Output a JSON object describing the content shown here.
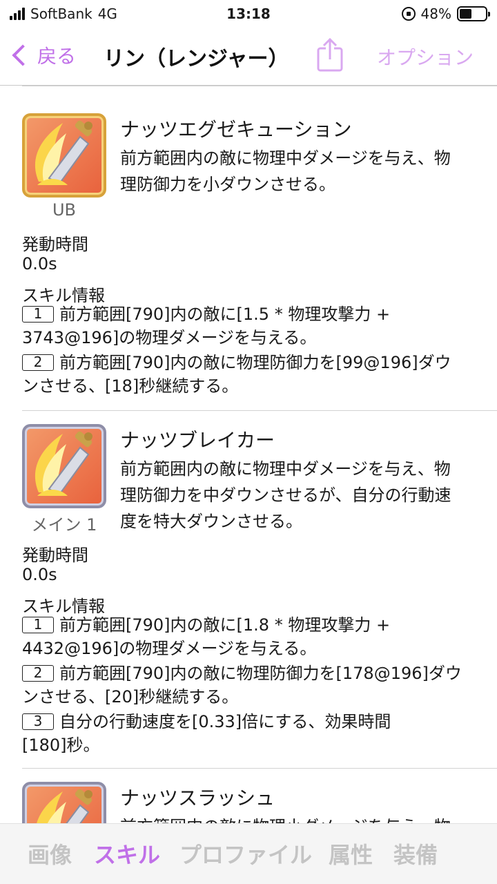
{
  "status": {
    "carrier": "SoftBank",
    "network": "4G",
    "time": "13:18",
    "battery": "48%",
    "battery_level": 0.48
  },
  "nav": {
    "back_label": "戻る",
    "title": "リン（レンジャー）",
    "options_label": "オプション"
  },
  "skills": [
    {
      "name": "ナッツエグゼキューション",
      "label": "UB",
      "desc_lines": [
        "前方範囲内の敵に物理中ダメージを与え、物",
        "理防御力を小ダウンさせる。"
      ],
      "cast_time_label": "発動時間",
      "cast_time": "0.0s",
      "info_label": "スキル情報",
      "info": [
        {
          "num": "1",
          "lines": [
            "前方範囲[790]内の敵に[1.5 * 物理攻撃力 +",
            "3743@196]の物理ダメージを与える。"
          ]
        },
        {
          "num": "2",
          "lines": [
            "前方範囲[790]内の敵に物理防御力を[99@196]ダウ",
            "ンさせる、[18]秒継続する。"
          ]
        }
      ]
    },
    {
      "name": "ナッツブレイカー",
      "label": "メイン 1",
      "desc_lines": [
        "前方範囲内の敵に物理中ダメージを与え、物",
        "理防御力を中ダウンさせるが、自分の行動速",
        "度を特大ダウンさせる。"
      ],
      "cast_time_label": "発動時間",
      "cast_time": "0.0s",
      "info_label": "スキル情報",
      "info": [
        {
          "num": "1",
          "lines": [
            "前方範囲[790]内の敵に[1.8 * 物理攻撃力 +",
            "4432@196]の物理ダメージを与える。"
          ]
        },
        {
          "num": "2",
          "lines": [
            "前方範囲[790]内の敵に物理防御力を[178@196]ダウ",
            "ンさせる、[20]秒継続する。"
          ]
        },
        {
          "num": "3",
          "lines": [
            "自分の行動速度を[0.33]倍にする、効果時間",
            "[180]秒。"
          ]
        }
      ]
    },
    {
      "name": "ナッツスラッシュ",
      "desc_lines": [
        "前方範囲内の敵に物理小ダメージを与え、物"
      ]
    }
  ],
  "tabs": [
    {
      "label": "画像",
      "active": false
    },
    {
      "label": "スキル",
      "active": true
    },
    {
      "label": "プロファイル",
      "active": false
    },
    {
      "label": "属性",
      "active": false
    },
    {
      "label": "装備",
      "active": false
    }
  ],
  "colors": {
    "accent": "#c070e8",
    "accent_light": "#d9a8f0",
    "tab_inactive": "#c4c4c4"
  }
}
